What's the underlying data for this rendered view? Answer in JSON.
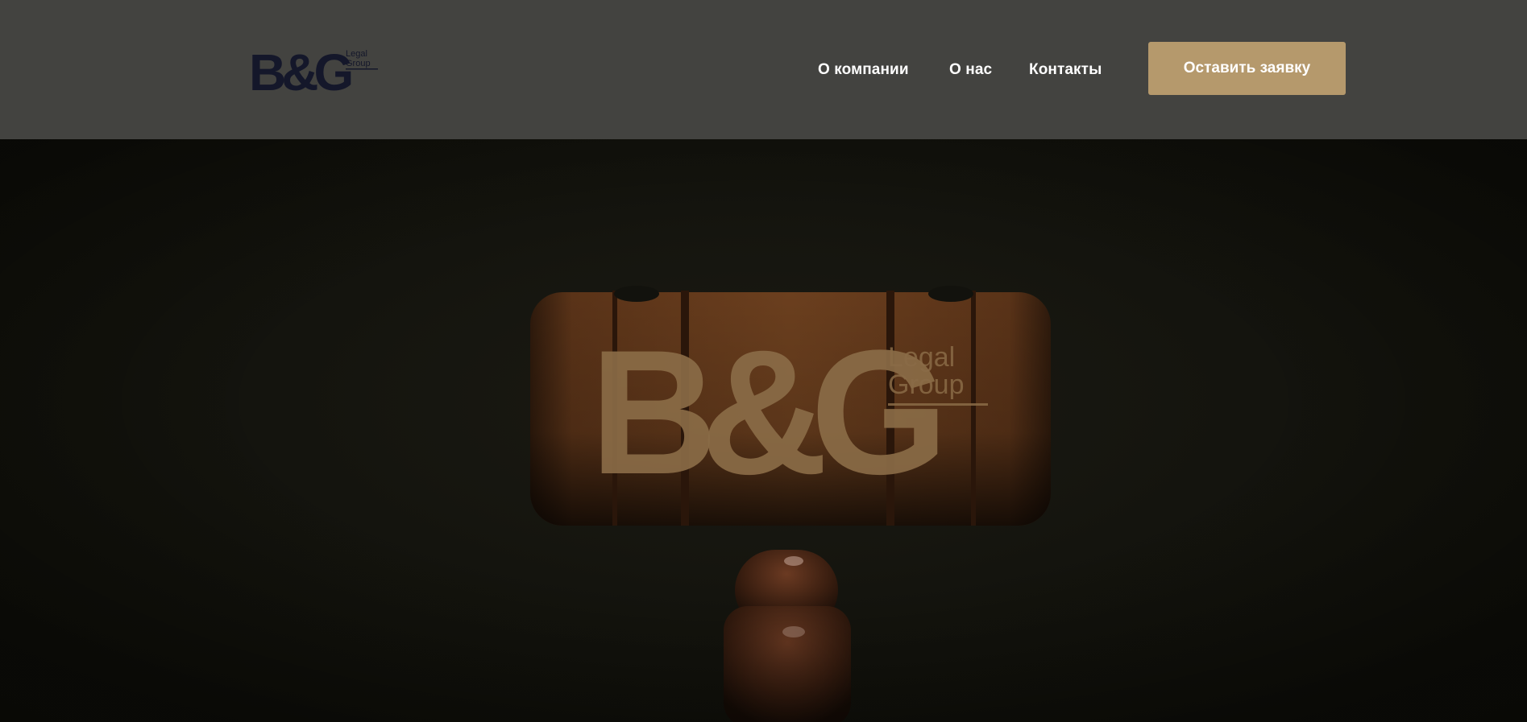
{
  "header": {
    "logo": {
      "main_text": "B&G",
      "sub_line1": "Legal",
      "sub_line2": "Group",
      "color": "#14172a"
    },
    "nav": {
      "items": [
        {
          "label": "О компании"
        },
        {
          "label": "О нас"
        },
        {
          "label": "Контакты"
        }
      ]
    },
    "cta_label": "Оставить заявку",
    "background": "#434340",
    "accent": "#b5996c"
  },
  "hero": {
    "logo": {
      "main_text": "B&G",
      "sub_line1": "Legal",
      "sub_line2": "Group",
      "color": "#8a6b47"
    },
    "background_image": "wooden-gavel-photo"
  }
}
